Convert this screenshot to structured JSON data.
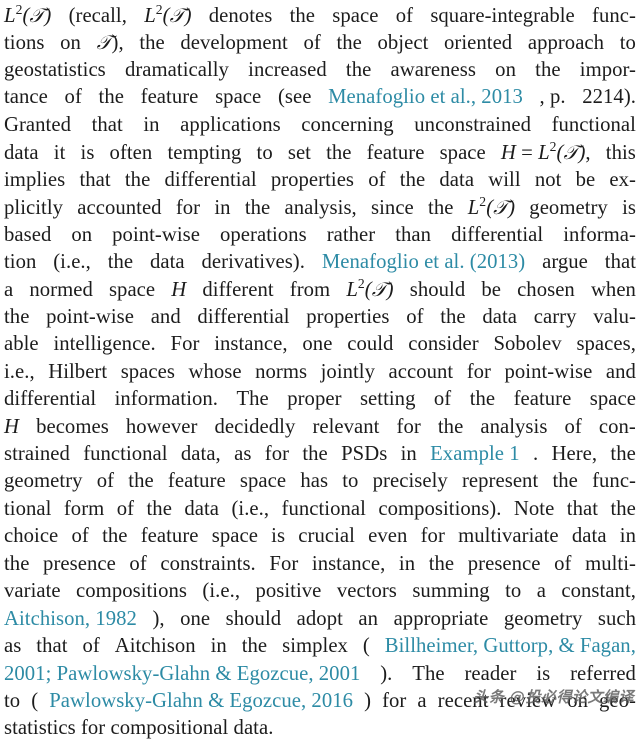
{
  "document": {
    "type": "academic-paper-body-text",
    "link_color": "#2d8ba5",
    "text_color": "#1c1c1c",
    "background_color": "#ffffff",
    "paragraph_plain_text": "L2(T) (recall, L2(T) denotes the space of square-integrable functions on T), the development of the object oriented approach to geostatistics dramatically increased the awareness on the importance of the feature space (see Menafoglio et al., 2013, p. 2214). Granted that in applications concerning unconstrained functional data it is often tempting to set the feature space H = L2(T), this implies that the differential properties of the data will not be explicitly accounted for in the analysis, since the L2(T) geometry is based on point-wise operations rather than differential information (i.e., the data derivatives). Menafoglio et al. (2013) argue that a normed space H different from L2(T) should be chosen when the point-wise and differential properties of the data carry valuable intelligence. For instance, one could consider Sobolev spaces, i.e., Hilbert spaces whose norms jointly account for point-wise and differential information. The proper setting of the feature space H becomes however decidedly relevant for the analysis of constrained functional data, as for the PSDs in Example 1. Here, the geometry of the feature space has to precisely represent the functional form of the data (i.e., functional compositions). Note that the choice of the feature space is crucial even for multivariate data in the presence of constraints. For instance, in the presence of multivariate compositions (i.e., positive vectors summing to a constant, Aitchison, 1982), one should adopt an appropriate geometry such as that of Aitchison in the simplex (Billheimer, Guttorp, & Fagan, 2001; Pawlowsky-Glahn & Egozcue, 2001). The reader is referred to (Pawlowsky-Glahn & Egozcue, 2016) for a recent review on geostatistics for compositional data.",
    "citations": [
      "Menafoglio et al., 2013",
      "Menafoglio et al. (2013)",
      "Example 1",
      "Aitchison, 1982",
      "Billheimer, Guttorp, & Fagan, 2001; Pawlowsky-Glahn & Egozcue, 2001",
      "Pawlowsky-Glahn & Egozcue, 2016"
    ],
    "lines": [
      {
        "id": "l1",
        "words": [
          "L²(𝒯)",
          "(recall,",
          "L²(𝒯)",
          "denotes",
          "the",
          "space",
          "of",
          "square-integrable",
          "func-"
        ]
      },
      {
        "id": "l2",
        "words": [
          "tions",
          "on",
          "𝒯),",
          "the",
          "development",
          "of",
          "the",
          "object",
          "oriented",
          "approach",
          "to"
        ]
      },
      {
        "id": "l3",
        "words": [
          "geostatistics",
          "dramatically",
          "increased",
          "the",
          "awareness",
          "on",
          "the",
          "impor-"
        ]
      },
      {
        "id": "l4",
        "words": [
          "tance",
          "of",
          "the",
          "feature",
          "space",
          "(see",
          "Menafoglio et al., 2013",
          ",",
          "p.",
          "2214)."
        ]
      },
      {
        "id": "l5",
        "words": [
          "Granted",
          "that",
          "in",
          "applications",
          "concerning",
          "unconstrained",
          "functional"
        ]
      },
      {
        "id": "l6",
        "words": [
          "data",
          "it",
          "is",
          "often",
          "tempting",
          "to",
          "set",
          "the",
          "feature",
          "space",
          "H = L²(𝒯),",
          "this"
        ]
      },
      {
        "id": "l7",
        "words": [
          "implies",
          "that",
          "the",
          "differential",
          "properties",
          "of",
          "the",
          "data",
          "will",
          "not",
          "be",
          "ex-"
        ]
      },
      {
        "id": "l8",
        "words": [
          "plicitly",
          "accounted",
          "for",
          "in",
          "the",
          "analysis,",
          "since",
          "the",
          "L²(𝒯)",
          "geometry",
          "is"
        ]
      },
      {
        "id": "l9",
        "words": [
          "based",
          "on",
          "point-wise",
          "operations",
          "rather",
          "than",
          "differential",
          "informa-"
        ]
      },
      {
        "id": "l10",
        "words": [
          "tion",
          "(i.e.,",
          "the",
          "data",
          "derivatives).",
          "Menafoglio et al. (2013)",
          "argue",
          "that"
        ]
      },
      {
        "id": "l11",
        "words": [
          "a",
          "normed",
          "space",
          "H",
          "different",
          "from",
          "L²(𝒯)",
          "should",
          "be",
          "chosen",
          "when"
        ]
      },
      {
        "id": "l12",
        "words": [
          "the",
          "point-wise",
          "and",
          "differential",
          "properties",
          "of",
          "the",
          "data",
          "carry",
          "valu-"
        ]
      },
      {
        "id": "l13",
        "words": [
          "able",
          "intelligence.",
          "For",
          "instance,",
          "one",
          "could",
          "consider",
          "Sobolev",
          "spaces,"
        ]
      },
      {
        "id": "l14",
        "words": [
          "i.e.,",
          "Hilbert",
          "spaces",
          "whose",
          "norms",
          "jointly",
          "account",
          "for",
          "point-wise",
          "and"
        ]
      },
      {
        "id": "l15",
        "words": [
          "differential",
          "information.",
          "The",
          "proper",
          "setting",
          "of",
          "the",
          "feature",
          "space"
        ]
      },
      {
        "id": "l16",
        "words": [
          "H",
          "becomes",
          "however",
          "decidedly",
          "relevant",
          "for",
          "the",
          "analysis",
          "of",
          "con-"
        ]
      },
      {
        "id": "l17",
        "words": [
          "strained",
          "functional",
          "data,",
          "as",
          "for",
          "the",
          "PSDs",
          "in",
          "Example 1",
          ".",
          "Here,",
          "the"
        ]
      },
      {
        "id": "l18",
        "words": [
          "geometry",
          "of",
          "the",
          "feature",
          "space",
          "has",
          "to",
          "precisely",
          "represent",
          "the",
          "func-"
        ]
      },
      {
        "id": "l19",
        "words": [
          "tional",
          "form",
          "of",
          "the",
          "data",
          "(i.e.,",
          "functional",
          "compositions).",
          "Note",
          "that",
          "the"
        ]
      },
      {
        "id": "l20",
        "words": [
          "choice",
          "of",
          "the",
          "feature",
          "space",
          "is",
          "crucial",
          "even",
          "for",
          "multivariate",
          "data",
          "in"
        ]
      },
      {
        "id": "l21",
        "words": [
          "the",
          "presence",
          "of",
          "constraints.",
          "For",
          "instance,",
          "in",
          "the",
          "presence",
          "of",
          "multi-"
        ]
      },
      {
        "id": "l22",
        "words": [
          "variate",
          "compositions",
          "(i.e.,",
          "positive",
          "vectors",
          "summing",
          "to",
          "a",
          "constant,"
        ]
      },
      {
        "id": "l23",
        "words": [
          "Aitchison, 1982",
          "),",
          "one",
          "should",
          "adopt",
          "an",
          "appropriate",
          "geometry",
          "such"
        ]
      },
      {
        "id": "l24",
        "words": [
          "as",
          "that",
          "of",
          "Aitchison",
          "in",
          "the",
          "simplex",
          "(",
          "Billheimer, Guttorp, & Fagan,"
        ]
      },
      {
        "id": "l25",
        "words": [
          "2001; Pawlowsky-Glahn & Egozcue, 2001",
          ").",
          "The",
          "reader",
          "is",
          "referred"
        ]
      },
      {
        "id": "l26",
        "words": [
          "to",
          "(",
          "Pawlowsky-Glahn & Egozcue, 2016",
          ")",
          "for",
          "a",
          "recent",
          "review",
          "on",
          "geo-"
        ]
      },
      {
        "id": "l27",
        "words": [
          "statistics",
          "for",
          "compositional",
          "data."
        ]
      }
    ]
  },
  "watermark": {
    "text": "头条 @投必得论文编译"
  }
}
